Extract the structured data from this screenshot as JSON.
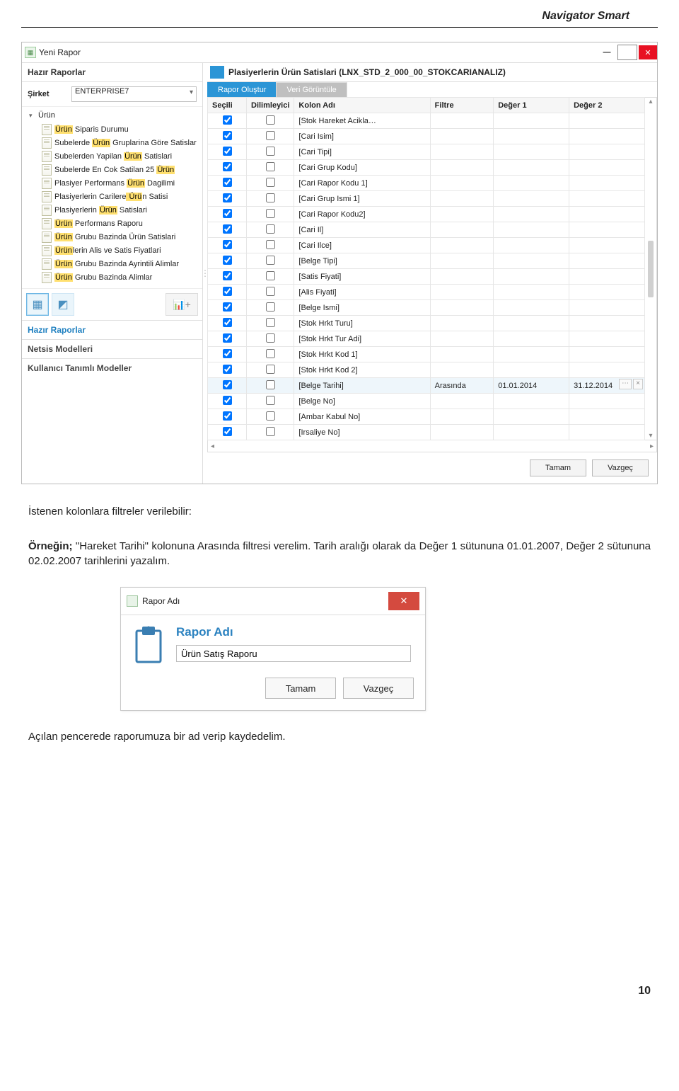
{
  "page_header": "Navigator Smart",
  "page_number": "10",
  "window": {
    "title": "Yeni Rapor",
    "min": "—",
    "max": "▭",
    "close": "✕"
  },
  "left": {
    "hazir_raporlar": "Hazır Raporlar",
    "sirket_label": "Şirket",
    "sirket_value": "ENTERPRISE7",
    "tree_root": "Ürün",
    "items": [
      {
        "t": "Ürün Siparis Durumu",
        "m": [
          [
            0,
            4
          ]
        ]
      },
      {
        "t": "Subelerde Ürün Gruplarina Göre Satislar",
        "m": [
          [
            10,
            4
          ]
        ]
      },
      {
        "t": "Subelerden Yapilan Ürün Satislari",
        "m": [
          [
            19,
            4
          ]
        ]
      },
      {
        "t": "Subelerde En Cok Satilan 25 Ürün",
        "m": [
          [
            28,
            4
          ]
        ]
      },
      {
        "t": "Plasiyer Performans Ürün Dagilimi",
        "m": [
          [
            20,
            4
          ]
        ]
      },
      {
        "t": "Plasiyerlerin Carilere Ürün Satisi",
        "m": [
          [
            22,
            4
          ]
        ]
      },
      {
        "t": "Plasiyerlerin Ürün Satislari",
        "m": [
          [
            14,
            4
          ]
        ]
      },
      {
        "t": "Ürün Performans Raporu",
        "m": [
          [
            0,
            4
          ]
        ]
      },
      {
        "t": "Ürün Grubu Bazinda Ürün Satislari",
        "m": [
          [
            0,
            4
          ]
        ]
      },
      {
        "t": "Ürünlerin Alis ve Satis Fiyatlari",
        "m": [
          [
            0,
            4
          ]
        ]
      },
      {
        "t": "Ürün Grubu Bazinda Ayrintili Alimlar",
        "m": [
          [
            0,
            4
          ]
        ]
      },
      {
        "t": "Ürün Grubu Bazinda Alimlar",
        "m": [
          [
            0,
            4
          ]
        ]
      }
    ],
    "accordion": {
      "hazir": "Hazır Raporlar",
      "netsis": "Netsis Modelleri",
      "kullanici": "Kullanıcı Tanımlı Modeller"
    }
  },
  "right": {
    "title": "Plasiyerlerin Ürün Satislari (LNX_STD_2_000_00_STOKCARIANALIZ)",
    "tabs": {
      "active": "Rapor Oluştur",
      "inactive": "Veri Görüntüle"
    },
    "cols": {
      "secili": "Seçili",
      "dilimleyici": "Dilimleyici",
      "kolon": "Kolon Adı",
      "filtre": "Filtre",
      "d1": "Değer 1",
      "d2": "Değer 2"
    },
    "rows": [
      {
        "s": true,
        "d": false,
        "k": "[Stok Hareket Acikla…"
      },
      {
        "s": true,
        "d": false,
        "k": "[Cari Isim]"
      },
      {
        "s": true,
        "d": false,
        "k": "[Cari Tipi]"
      },
      {
        "s": true,
        "d": false,
        "k": "[Cari Grup Kodu]"
      },
      {
        "s": true,
        "d": false,
        "k": "[Cari Rapor Kodu 1]"
      },
      {
        "s": true,
        "d": false,
        "k": "[Cari Grup Ismi 1]"
      },
      {
        "s": true,
        "d": false,
        "k": "[Cari Rapor Kodu2]"
      },
      {
        "s": true,
        "d": false,
        "k": "[Cari Il]"
      },
      {
        "s": true,
        "d": false,
        "k": "[Cari Ilce]"
      },
      {
        "s": true,
        "d": false,
        "k": "[Belge Tipi]"
      },
      {
        "s": true,
        "d": false,
        "k": "[Satis Fiyati]"
      },
      {
        "s": true,
        "d": false,
        "k": "[Alis Fiyati]"
      },
      {
        "s": true,
        "d": false,
        "k": "[Belge Ismi]"
      },
      {
        "s": true,
        "d": false,
        "k": "[Stok Hrkt Turu]"
      },
      {
        "s": true,
        "d": false,
        "k": "[Stok Hrkt Tur Adi]"
      },
      {
        "s": true,
        "d": false,
        "k": "[Stok Hrkt Kod 1]"
      },
      {
        "s": true,
        "d": false,
        "k": "[Stok Hrkt Kod 2]"
      },
      {
        "s": true,
        "d": false,
        "k": "[Belge Tarihi]",
        "f": "Arasında",
        "v1": "01.01.2014",
        "v2": "31.12.2014",
        "sel": true,
        "caret": true
      },
      {
        "s": true,
        "d": false,
        "k": "[Belge No]"
      },
      {
        "s": true,
        "d": false,
        "k": "[Ambar Kabul No]"
      },
      {
        "s": true,
        "d": false,
        "k": "[Irsaliye No]"
      }
    ],
    "buttons": {
      "ok": "Tamam",
      "cancel": "Vazgeç"
    }
  },
  "body1": "İstenen kolonlara filtreler verilebilir:",
  "body2a": "Örneğin;",
  "body2b": " \"Hareket Tarihi\" kolonuna Arasında filtresi verelim. Tarih aralığı olarak da Değer 1 sütununa 01.01.2007, Değer 2 sütununa 02.02.2007 tarihlerini yazalım.",
  "dialog": {
    "title": "Rapor Adı",
    "heading": "Rapor Adı",
    "value": "Ürün Satış Raporu",
    "ok": "Tamam",
    "cancel": "Vazgeç",
    "close": "✕"
  },
  "body3": "Açılan pencerede raporumuza bir ad verip kaydedelim."
}
